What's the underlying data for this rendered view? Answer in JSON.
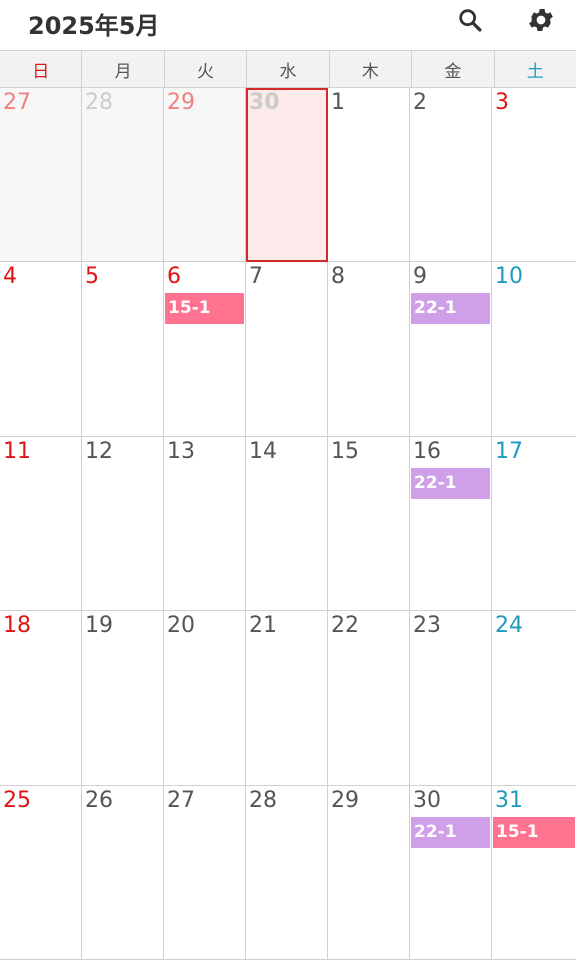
{
  "header": {
    "title": "2025年5月",
    "search_icon": "search-icon",
    "settings_icon": "gear-icon"
  },
  "colors": {
    "sunday": "#e01414",
    "saturday": "#1e9bbf",
    "weekday": "#555555",
    "other_month_sunday": "#f08080",
    "other_month": "#cccccc",
    "today_bg": "#fdeaea",
    "today_border": "#d42a2a",
    "event_pink": "#ff7390",
    "event_purple": "#cf9fe8"
  },
  "weekdays": [
    "日",
    "月",
    "火",
    "水",
    "木",
    "金",
    "土"
  ],
  "weeks": [
    [
      {
        "day": "27",
        "kind": "other_sun"
      },
      {
        "day": "28",
        "kind": "other"
      },
      {
        "day": "29",
        "kind": "other_sun"
      },
      {
        "day": "30",
        "kind": "other_today"
      },
      {
        "day": "1",
        "kind": "weekday"
      },
      {
        "day": "2",
        "kind": "weekday"
      },
      {
        "day": "3",
        "kind": "holiday"
      }
    ],
    [
      {
        "day": "4",
        "kind": "holiday"
      },
      {
        "day": "5",
        "kind": "holiday"
      },
      {
        "day": "6",
        "kind": "holiday",
        "event": {
          "label": "15-1",
          "color": "pink"
        }
      },
      {
        "day": "7",
        "kind": "weekday"
      },
      {
        "day": "8",
        "kind": "weekday"
      },
      {
        "day": "9",
        "kind": "weekday",
        "event": {
          "label": "22-1",
          "color": "purple"
        }
      },
      {
        "day": "10",
        "kind": "saturday"
      }
    ],
    [
      {
        "day": "11",
        "kind": "holiday"
      },
      {
        "day": "12",
        "kind": "weekday"
      },
      {
        "day": "13",
        "kind": "weekday"
      },
      {
        "day": "14",
        "kind": "weekday"
      },
      {
        "day": "15",
        "kind": "weekday"
      },
      {
        "day": "16",
        "kind": "weekday",
        "event": {
          "label": "22-1",
          "color": "purple"
        }
      },
      {
        "day": "17",
        "kind": "saturday"
      }
    ],
    [
      {
        "day": "18",
        "kind": "holiday"
      },
      {
        "day": "19",
        "kind": "weekday"
      },
      {
        "day": "20",
        "kind": "weekday"
      },
      {
        "day": "21",
        "kind": "weekday"
      },
      {
        "day": "22",
        "kind": "weekday"
      },
      {
        "day": "23",
        "kind": "weekday"
      },
      {
        "day": "24",
        "kind": "saturday"
      }
    ],
    [
      {
        "day": "25",
        "kind": "holiday"
      },
      {
        "day": "26",
        "kind": "weekday"
      },
      {
        "day": "27",
        "kind": "weekday"
      },
      {
        "day": "28",
        "kind": "weekday"
      },
      {
        "day": "29",
        "kind": "weekday"
      },
      {
        "day": "30",
        "kind": "weekday",
        "event": {
          "label": "22-1",
          "color": "purple"
        }
      },
      {
        "day": "31",
        "kind": "saturday",
        "event": {
          "label": "15-1",
          "color": "pink"
        }
      }
    ]
  ]
}
